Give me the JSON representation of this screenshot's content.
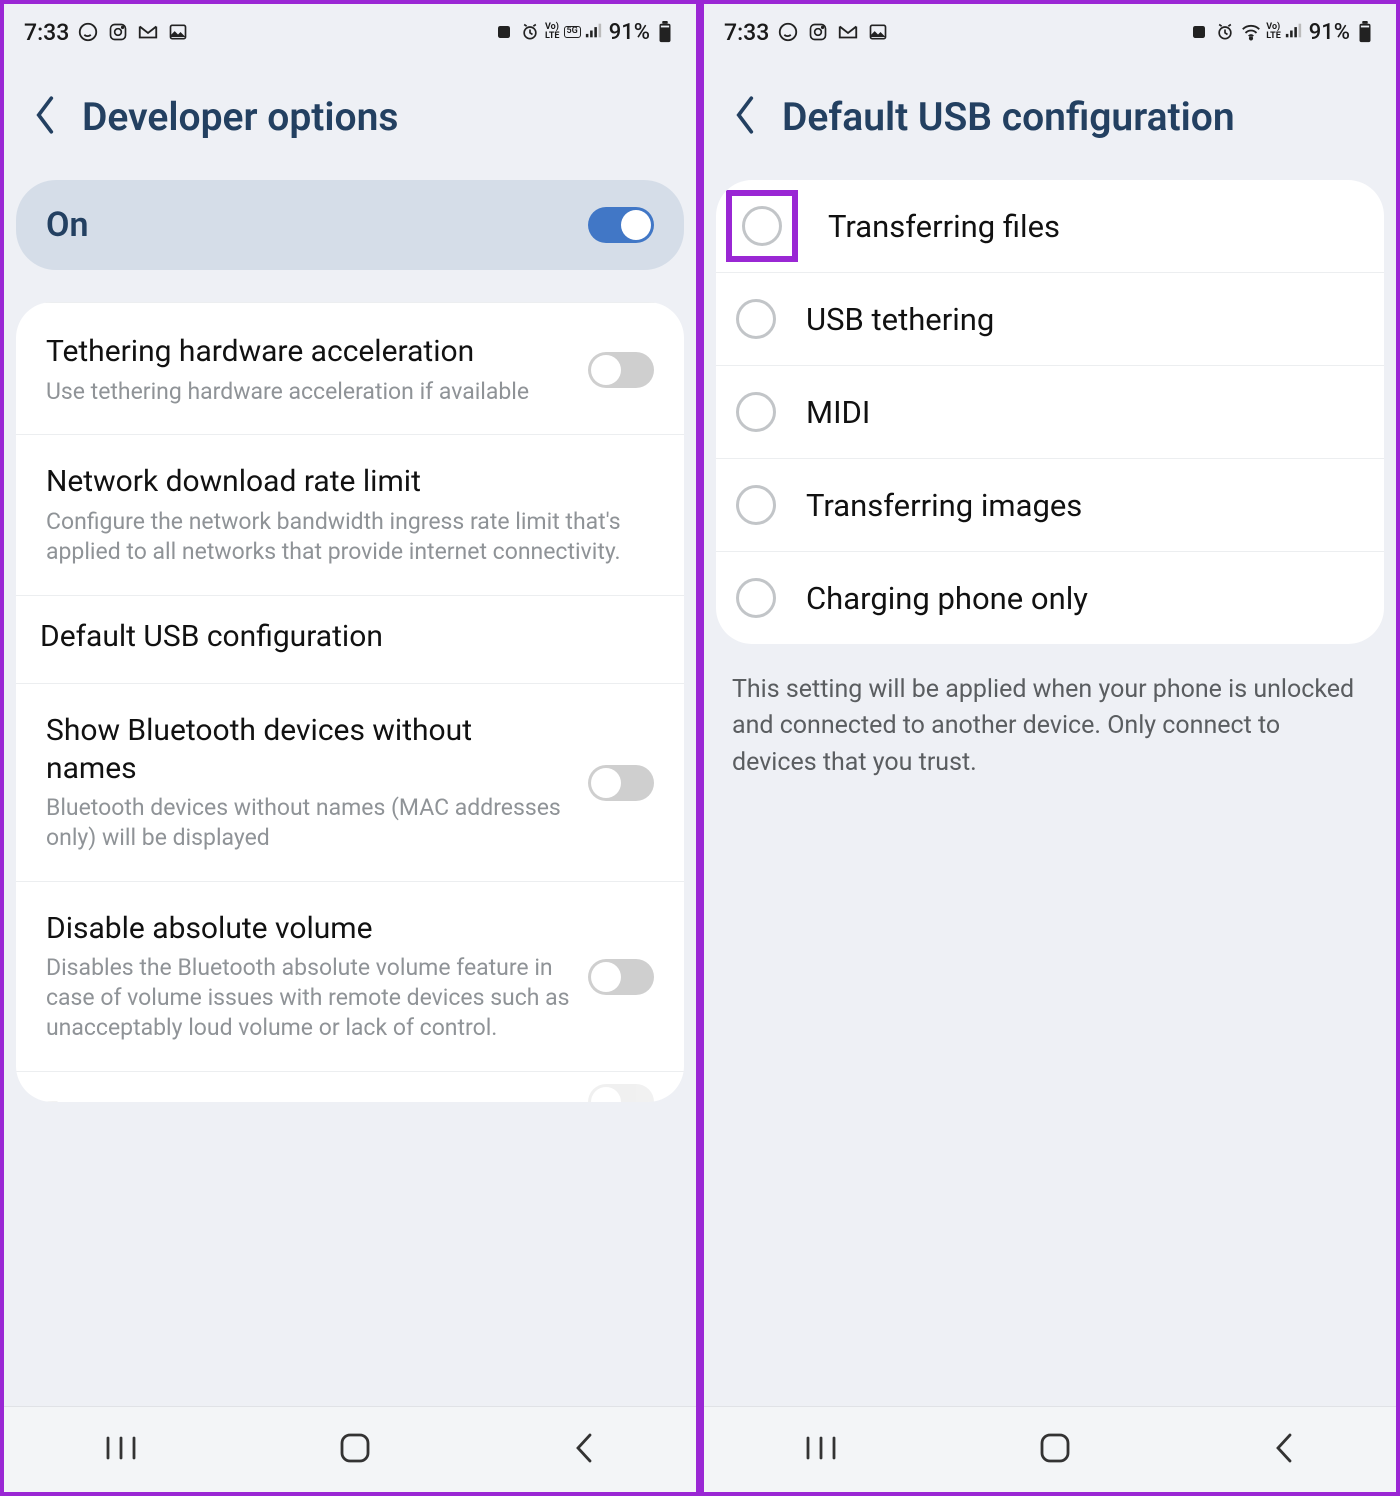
{
  "status": {
    "time": "7:33",
    "battery_pct": "91%",
    "icons_left": [
      "whatsapp",
      "instagram",
      "gmail",
      "gallery"
    ],
    "net_labels": {
      "volte": "Vo\nLTE",
      "fiveg": "5G"
    }
  },
  "left": {
    "header_title": "Developer options",
    "master": {
      "label": "On",
      "state": true
    },
    "options": [
      {
        "title": "Tethering hardware acceleration",
        "subtitle": "Use tethering hardware acceleration if available",
        "toggle": false
      },
      {
        "title": "Network download rate limit",
        "subtitle": "Configure the network bandwidth ingress rate limit that's applied to all networks that provide internet connectivity."
      },
      {
        "title": "Default USB configuration",
        "highlighted": true
      },
      {
        "title": "Show Bluetooth devices without names",
        "subtitle": "Bluetooth devices without names (MAC addresses only) will be displayed",
        "toggle": false
      },
      {
        "title": "Disable absolute volume",
        "subtitle": "Disables the Bluetooth absolute volume feature in case of volume issues with remote devices such as unacceptably loud volume or lack of control.",
        "toggle": false
      }
    ]
  },
  "right": {
    "header_title": "Default USB configuration",
    "radios": [
      {
        "label": "Transferring files",
        "highlighted": true
      },
      {
        "label": "USB tethering"
      },
      {
        "label": "MIDI"
      },
      {
        "label": "Transferring images"
      },
      {
        "label": "Charging phone only"
      }
    ],
    "footer": "This setting will be applied when your phone is unlocked and connected to another device. Only connect to devices that you trust."
  }
}
